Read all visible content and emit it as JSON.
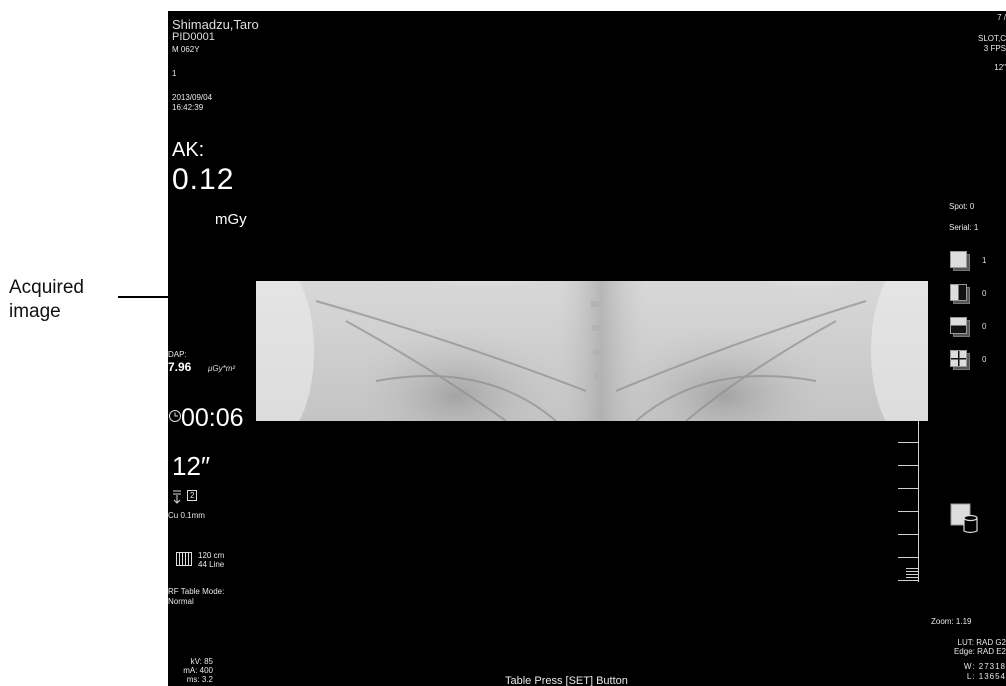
{
  "callout": {
    "line1": "Acquired",
    "line2": "image"
  },
  "patient": {
    "name": "Shimadzu,Taro",
    "pid": "PID0001",
    "sex_age": "M 062Y",
    "series": "1",
    "date": "2013/09/04",
    "time": "16:42:39"
  },
  "top_right": {
    "frame": "7 /",
    "slot": "SLOT,C",
    "fps": "3 FPS",
    "size": "12\""
  },
  "dose": {
    "ak_label": "AK:",
    "ak_value": "0.12",
    "ak_unit": "mGy",
    "dap_label": "DAP:",
    "dap_value": "7.96",
    "dap_unit": "μGy*m²"
  },
  "timer": {
    "value": "00:06"
  },
  "field": {
    "size": "12″",
    "grid_num": "2",
    "filter": "Cu 0.1mm",
    "grid_distance": "120 cm",
    "grid_lines": "44 Line",
    "table_mode_label": "RF Table Mode:",
    "table_mode_value": "Normal"
  },
  "exposure": {
    "kv": "kV: 85",
    "ma": "mA: 400",
    "ms": "ms: 3.2"
  },
  "message": "Table Press [SET] Button",
  "counters": {
    "spot": "Spot: 0",
    "serial": "Serial: 1"
  },
  "layouts": [
    {
      "name": "layout-single",
      "count": "1"
    },
    {
      "name": "layout-split-vertical",
      "count": "0"
    },
    {
      "name": "layout-split-horizontal",
      "count": "0"
    },
    {
      "name": "layout-quad",
      "count": "0"
    }
  ],
  "display": {
    "zoom": "Zoom: 1.19",
    "lut": "LUT: RAD G2",
    "edge": "Edge: RAD E2",
    "w": "W: 27318",
    "l": "L: 13654"
  }
}
